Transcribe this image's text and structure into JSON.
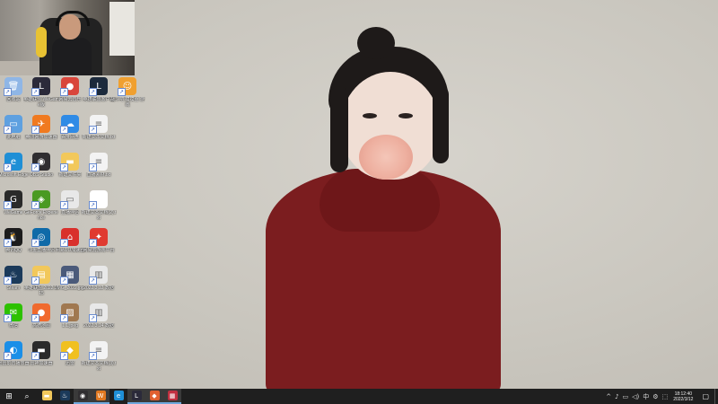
{
  "desktop": {
    "icons": [
      {
        "id": "i1",
        "label": "回收站",
        "icon": "recycle-bin-icon",
        "color": "#8fb6e6",
        "glyph": "🗑"
      },
      {
        "id": "i2",
        "label": "英雄联盟 WeGame版",
        "icon": "league-of-legends-icon",
        "color": "#2b2a3a",
        "glyph": "L"
      },
      {
        "id": "i3",
        "label": "网易云音乐",
        "icon": "game-character-icon",
        "color": "#d9463b",
        "glyph": "●"
      },
      {
        "id": "i4",
        "label": "英雄联盟客户端",
        "icon": "league-client-icon",
        "color": "#1c2a3c",
        "glyph": "L"
      },
      {
        "id": "i5",
        "label": "战斗吧 摸摸鱼 游戏",
        "icon": "cartoon-character-icon",
        "color": "#f0a030",
        "glyph": "☺"
      },
      {
        "id": "i6",
        "label": "此电脑",
        "icon": "computer-icon",
        "color": "#5ea0e0",
        "glyph": "▭"
      },
      {
        "id": "i7",
        "label": "腾讯网游加速器",
        "icon": "tencent-accelerator-icon",
        "color": "#f07a20",
        "glyph": "✈"
      },
      {
        "id": "i8",
        "label": "百度网盘",
        "icon": "cloud-drive-icon",
        "color": "#2f8be6",
        "glyph": "☁"
      },
      {
        "id": "i9",
        "label": "新建文本文档.txt",
        "icon": "text-file-icon",
        "color": "#f3f3f3",
        "glyph": "≡"
      },
      {
        "id": "i10",
        "label": "Microsoft Edge",
        "icon": "edge-browser-icon",
        "color": "#1f8fd6",
        "glyph": "e"
      },
      {
        "id": "i11",
        "label": "OBS Studio",
        "icon": "obs-studio-icon",
        "color": "#302e31",
        "glyph": "◉"
      },
      {
        "id": "i12",
        "label": "新建文件夹",
        "icon": "folder-icon",
        "color": "#f2c85b",
        "glyph": "▬"
      },
      {
        "id": "i13",
        "label": "直播素材.txt",
        "icon": "text-file-icon",
        "color": "#f3f3f3",
        "glyph": "≡"
      },
      {
        "id": "i14",
        "label": "WeGame",
        "icon": "wegame-icon",
        "color": "#2a2a2a",
        "glyph": "G"
      },
      {
        "id": "i15",
        "label": "GeForce Experience",
        "icon": "nvidia-icon",
        "color": "#4a9a22",
        "glyph": "◈"
      },
      {
        "id": "i16",
        "label": "直播伴侣",
        "icon": "window-app-icon",
        "color": "#e8e8e8",
        "glyph": "▭"
      },
      {
        "id": "i17",
        "label": "新建文本文档(2).txt",
        "icon": "blank-file-icon",
        "color": "#ffffff",
        "glyph": ""
      },
      {
        "id": "i18",
        "label": "腾讯QQ",
        "icon": "qq-icon",
        "color": "#1c1c1c",
        "glyph": "🐧"
      },
      {
        "id": "i19",
        "label": "斗鱼直播伴侣",
        "icon": "live-stream-icon",
        "color": "#0f6aa8",
        "glyph": "◎"
      },
      {
        "id": "i20",
        "label": "网易UU加速器",
        "icon": "uu-accelerator-icon",
        "color": "#d9302c",
        "glyph": "⌂"
      },
      {
        "id": "i21",
        "label": "网易云游戏平台",
        "icon": "netease-icon",
        "color": "#e03a30",
        "glyph": "✦"
      },
      {
        "id": "i22",
        "label": "Steam",
        "icon": "steam-icon",
        "color": "#1b3a5a",
        "glyph": "♨"
      },
      {
        "id": "i23",
        "label": "英雄联盟 2022.3.15",
        "icon": "document-folder-icon",
        "color": "#f2c85b",
        "glyph": "▤"
      },
      {
        "id": "i24",
        "label": "IMG_2022.jpg",
        "icon": "image-file-icon",
        "color": "#4a5a7a",
        "glyph": "▦"
      },
      {
        "id": "i25",
        "label": "2022.3.12 数据",
        "icon": "archive-icon",
        "color": "#e8e8e8",
        "glyph": "▥"
      },
      {
        "id": "i26",
        "label": "微信",
        "icon": "wechat-icon",
        "color": "#2dc100",
        "glyph": "✉"
      },
      {
        "id": "i27",
        "label": "高德地图",
        "icon": "map-pin-icon",
        "color": "#f06a2e",
        "glyph": "●"
      },
      {
        "id": "i28",
        "label": "1.1.jpeg",
        "icon": "photo-file-icon",
        "color": "#a07850",
        "glyph": "▨"
      },
      {
        "id": "i29",
        "label": "2022.3.14 数据",
        "icon": "archive-icon",
        "color": "#e8e8e8",
        "glyph": "▥"
      },
      {
        "id": "i30",
        "label": "迅雷影音播放器",
        "icon": "player-icon",
        "color": "#1a8fe8",
        "glyph": "◐"
      },
      {
        "id": "i31",
        "label": "雷神加速器",
        "icon": "keyboard-icon",
        "color": "#2a2a2a",
        "glyph": "▬"
      },
      {
        "id": "i32",
        "label": "迅雷",
        "icon": "thunder-icon",
        "color": "#f0c020",
        "glyph": "◆"
      },
      {
        "id": "i33",
        "label": "新建文本文档(3).txt",
        "icon": "text-file-icon",
        "color": "#f3f3f3",
        "glyph": "≡"
      }
    ]
  },
  "taskbar": {
    "start_glyph": "⊞",
    "search_glyph": "⌕",
    "apps": [
      {
        "id": "t1",
        "icon": "file-explorer-icon",
        "color": "#f2c85b",
        "glyph": "▬",
        "active": false
      },
      {
        "id": "t2",
        "icon": "steam-icon",
        "color": "#1b3a5a",
        "glyph": "♨",
        "active": false
      },
      {
        "id": "t3",
        "icon": "obs-studio-icon",
        "color": "#302e31",
        "glyph": "◉",
        "active": true
      },
      {
        "id": "t4",
        "icon": "wegame-icon",
        "color": "#e07820",
        "glyph": "W",
        "active": true
      },
      {
        "id": "t5",
        "icon": "edge-browser-icon",
        "color": "#1f8fd6",
        "glyph": "e",
        "active": false
      },
      {
        "id": "t6",
        "icon": "league-of-legends-icon",
        "color": "#2b2a3a",
        "glyph": "L",
        "active": true
      },
      {
        "id": "t7",
        "icon": "game-launcher-icon",
        "color": "#e06030",
        "glyph": "◆",
        "active": true
      },
      {
        "id": "t8",
        "icon": "photo-viewer-icon",
        "color": "#c03040",
        "glyph": "▦",
        "active": true
      }
    ],
    "tray": {
      "icons": [
        "^",
        "♪",
        "▭",
        "◁)",
        "中",
        "⚙",
        "⬚"
      ],
      "time": "18:12:40",
      "date": "2022/3/12",
      "notification_glyph": "▢"
    }
  }
}
